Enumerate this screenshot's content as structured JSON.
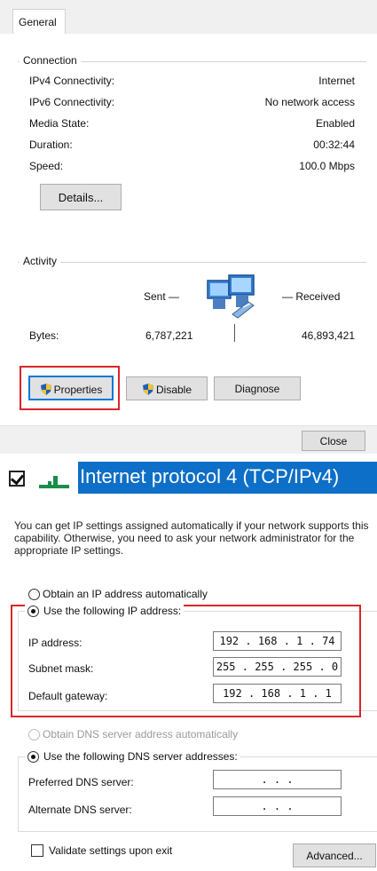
{
  "status_dialog": {
    "tab_general": "General",
    "connection_label": "Connection",
    "rows": [
      {
        "label": "IPv4 Connectivity:",
        "value": "Internet"
      },
      {
        "label": "IPv6 Connectivity:",
        "value": "No network access"
      },
      {
        "label": "Media State:",
        "value": "Enabled"
      },
      {
        "label": "Duration:",
        "value": "00:32:44"
      },
      {
        "label": "Speed:",
        "value": "100.0 Mbps"
      }
    ],
    "details_button": "Details...",
    "activity_label": "Activity",
    "sent_label": "Sent —",
    "received_label": "— Received",
    "bytes_label": "Bytes:",
    "bytes_sent": "6,787,221",
    "bytes_received": "46,893,421",
    "properties_button": "Properties",
    "disable_button": "Disable",
    "diagnose_button": "Diagnose",
    "close_button": "Close"
  },
  "protocol_item": {
    "checked": true,
    "label": "Internet protocol 4 (TCP/IPv4)"
  },
  "ipv4_dialog": {
    "description": "You can get IP settings assigned automatically if your network supports this capability. Otherwise, you need to ask your network administrator for the appropriate IP settings.",
    "obtain_ip_auto": "Obtain an IP address automatically",
    "use_following_ip": "Use the following IP address:",
    "ip_address_label": "IP address:",
    "ip_address_value": "192 . 168 .  1  . 74",
    "subnet_mask_label": "Subnet mask:",
    "subnet_mask_value": "255 . 255 . 255 .  0",
    "default_gateway_label": "Default gateway:",
    "default_gateway_value": "192 . 168 .  1  .  1",
    "obtain_dns_auto": "Obtain DNS server address automatically",
    "use_following_dns": "Use the following DNS server addresses:",
    "preferred_dns_label": "Preferred DNS server:",
    "preferred_dns_value": ".      .      .",
    "alternate_dns_label": "Alternate DNS server:",
    "alternate_dns_value": ".      .      .",
    "validate_label": "Validate settings upon exit",
    "advanced_button": "Advanced..."
  },
  "colors": {
    "highlight_red": "#d8262b",
    "protocol_blue": "#0d6fc7"
  }
}
